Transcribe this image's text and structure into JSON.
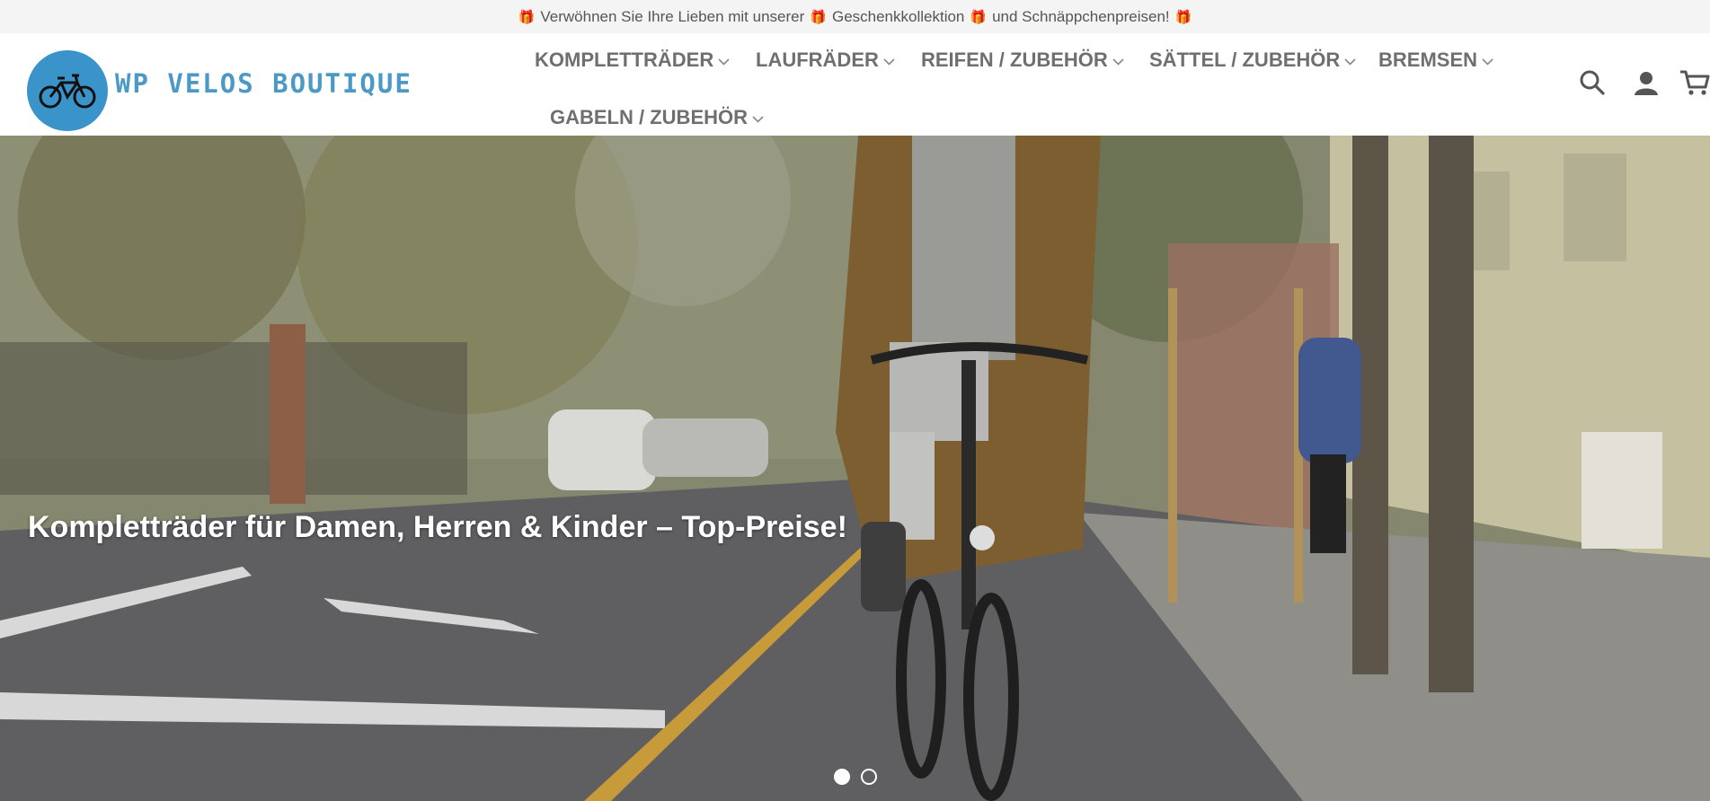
{
  "topbar": {
    "gift_icon": "gift-icon",
    "seg1": "Verwöhnen Sie Ihre Lieben mit unserer",
    "seg2": "Geschenkkollektion",
    "seg3": "und Schnäppchenpreisen!"
  },
  "logo": {
    "text": "WP VELOS BOUTIQUE",
    "bg_color": "#3b94c9",
    "icon": "bicycle-icon"
  },
  "nav": {
    "items": [
      {
        "label": "KOMPLETTRÄDER"
      },
      {
        "label": "LAUFRÄDER"
      },
      {
        "label": "REIFEN / ZUBEHÖR"
      },
      {
        "label": "SÄTTEL / ZUBEHÖR"
      },
      {
        "label": "BREMSEN"
      },
      {
        "label": "GABELN / ZUBEHÖR"
      }
    ]
  },
  "header_icons": {
    "search": "search-icon",
    "account": "user-icon",
    "cart": "cart-icon"
  },
  "hero": {
    "headline": "Kompletträder für Damen, Herren & Kinder – Top-Preise!",
    "slides_total": 2,
    "active_slide": 1
  }
}
